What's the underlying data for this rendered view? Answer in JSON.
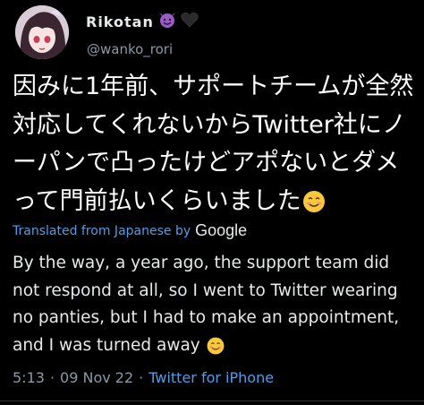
{
  "author": {
    "display_name": "Rikotan",
    "handle": "@wanko_rori",
    "badges": [
      "smiling-devil-icon",
      "black-heart-icon"
    ]
  },
  "tweet": {
    "text": "因みに1年前、サポートチームが全然対応してくれないからTwitter社にノーパンで凸ったけどアポないとダメって門前払いくらいました",
    "trailing_emoji": "smiling-face-icon"
  },
  "translation": {
    "label": "Translated from Japanese by",
    "provider": "Google",
    "text": "By the way, a year ago, the support team did not respond at all, so I went to Twitter wearing no panties, but I had to make an appointment, and I was turned away",
    "trailing_emoji": "smiling-face-icon"
  },
  "meta": {
    "time": "5:13",
    "date": "09 Nov 22",
    "separator": "·",
    "source": "Twitter for iPhone"
  },
  "colors": {
    "background": "#000000",
    "text": "#e7e9ea",
    "secondary": "#8b98a5",
    "link": "#4f9ee8"
  }
}
